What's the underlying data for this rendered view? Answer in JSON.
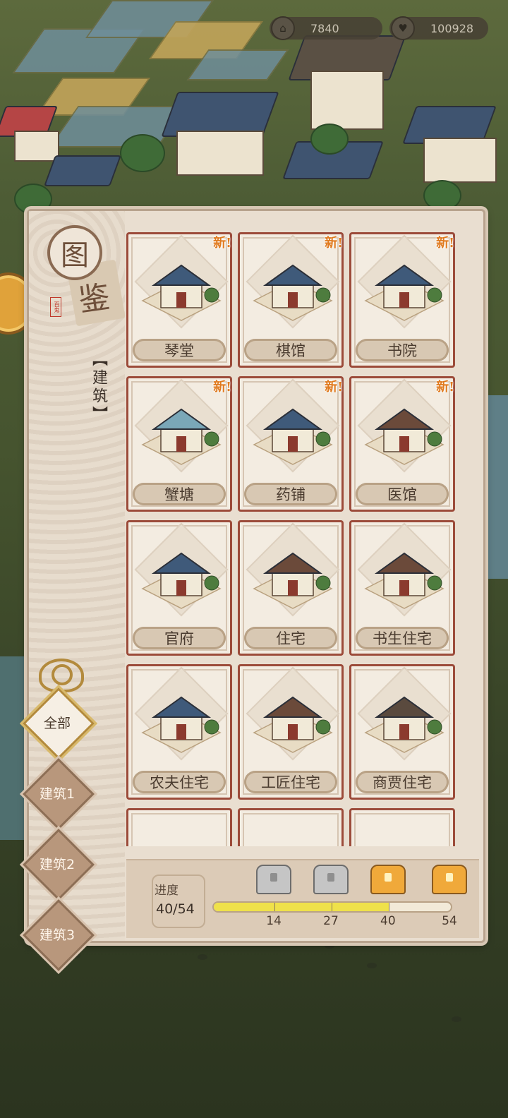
{
  "currency": {
    "coins": {
      "icon": "temple-coin-icon",
      "value": "7840"
    },
    "hearts": {
      "icon": "heart-icon",
      "value": "100928"
    }
  },
  "panel": {
    "title_char1": "图",
    "title_char2": "鉴",
    "seal_text": "百鬼",
    "category": "【建筑】"
  },
  "tabs": [
    {
      "label": "全部",
      "active": true
    },
    {
      "label": "建筑1",
      "active": false
    },
    {
      "label": "建筑2",
      "active": false
    },
    {
      "label": "建筑3",
      "active": false
    }
  ],
  "new_badge": "新!",
  "buildings": [
    {
      "name": "琴堂",
      "is_new": true,
      "icon": "pavilion-blossom-icon"
    },
    {
      "name": "棋馆",
      "is_new": true,
      "icon": "chess-hall-icon"
    },
    {
      "name": "书院",
      "is_new": true,
      "icon": "academy-icon"
    },
    {
      "name": "蟹塘",
      "is_new": true,
      "icon": "crab-pond-icon"
    },
    {
      "name": "药铺",
      "is_new": true,
      "icon": "pharmacy-icon"
    },
    {
      "name": "医馆",
      "is_new": true,
      "icon": "clinic-icon"
    },
    {
      "name": "官府",
      "is_new": false,
      "icon": "government-office-icon"
    },
    {
      "name": "住宅",
      "is_new": false,
      "icon": "residence-icon"
    },
    {
      "name": "书生住宅",
      "is_new": false,
      "icon": "scholar-house-icon"
    },
    {
      "name": "农夫住宅",
      "is_new": false,
      "icon": "farmer-house-icon"
    },
    {
      "name": "工匠住宅",
      "is_new": false,
      "icon": "craftsman-house-icon"
    },
    {
      "name": "商贾住宅",
      "is_new": false,
      "icon": "merchant-house-icon"
    }
  ],
  "progress": {
    "label": "进度",
    "value_text": "40/54",
    "current": 40,
    "total": 54,
    "milestones": [
      {
        "at": 14,
        "label": "14",
        "chest": "silver-chest-icon"
      },
      {
        "at": 27,
        "label": "27",
        "chest": "silver-chest-icon"
      },
      {
        "at": 40,
        "label": "40",
        "chest": "gold-chest-icon"
      },
      {
        "at": 54,
        "label": "54",
        "chest": "gold-chest-icon"
      }
    ]
  },
  "colors": {
    "card_border": "#9c4b3a",
    "new_badge": "#e07a1e",
    "progress_fill": "#efe14a"
  }
}
